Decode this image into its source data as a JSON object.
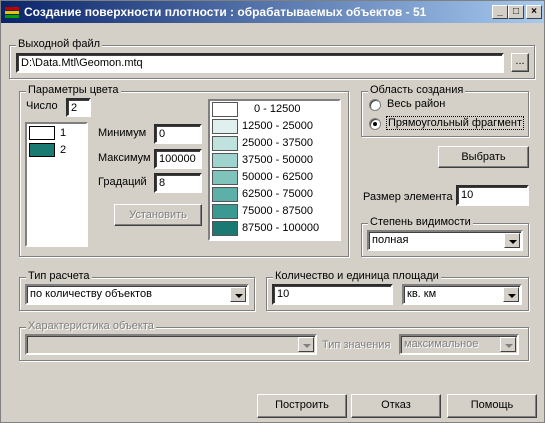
{
  "window": {
    "title": "Создание поверхности плотности : обрабатываемых объектов - 51",
    "minimize": "_",
    "maximize": "□",
    "close": "×"
  },
  "output": {
    "label": "Выходной файл",
    "path": "D:\\Data.Mtl\\Geomon.mtq",
    "browse_label": "..."
  },
  "color_params": {
    "label": "Параметры цвета",
    "count_label": "Число",
    "count_value": "2",
    "colors": [
      {
        "index": "1",
        "color": "#ffffff"
      },
      {
        "index": "2",
        "color": "#1a7a72"
      }
    ],
    "min_label": "Минимум",
    "min_value": "0",
    "max_label": "Максимум",
    "max_value": "100000",
    "grad_label": "Градаций",
    "grad_value": "8",
    "apply_label": "Установить",
    "ranges": [
      {
        "text": "0 - 12500",
        "color": "#ffffff"
      },
      {
        "text": "12500 - 25000",
        "color": "#dff0ee"
      },
      {
        "text": "25000 - 37500",
        "color": "#bfe2de"
      },
      {
        "text": "37500 - 50000",
        "color": "#9fd3cd"
      },
      {
        "text": "50000 - 62500",
        "color": "#7fc3bb"
      },
      {
        "text": "62500 - 75000",
        "color": "#5cb0a8"
      },
      {
        "text": "75000 - 87500",
        "color": "#3a9990"
      },
      {
        "text": "87500 - 100000",
        "color": "#1a7a72"
      }
    ]
  },
  "area": {
    "label": "Область создания",
    "option_all": "Весь район",
    "option_rect": "Прямоугольный фрагмент",
    "selected": "rect",
    "select_label": "Выбрать"
  },
  "element_size": {
    "label": "Размер элемента",
    "value": "10"
  },
  "visibility": {
    "label": "Степень видимости",
    "value": "полная"
  },
  "calc_type": {
    "label": "Тип расчета",
    "value": "по количеству объектов"
  },
  "area_unit": {
    "label": "Количество и единица площади",
    "value": "10",
    "unit": "кв. км"
  },
  "object_char": {
    "label": "Характеристика объекта",
    "value": "",
    "value_type_label": "Тип значения",
    "value_type": "максимальное"
  },
  "footer": {
    "build_label": "Построить",
    "cancel_label": "Отказ",
    "help_label": "Помощь"
  }
}
